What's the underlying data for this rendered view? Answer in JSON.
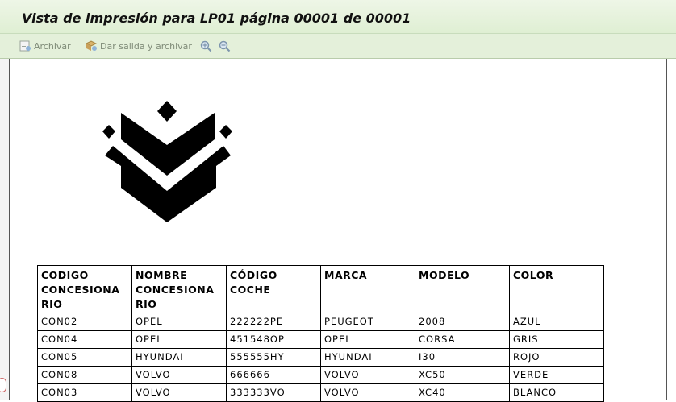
{
  "window": {
    "title": "Vista de impresión para LP01 página 00001 de 00001"
  },
  "toolbar": {
    "archive_label": "Archivar",
    "output_archive_label": "Dar salida y archivar",
    "zoom_in_icon": "zoom-in-icon",
    "zoom_out_icon": "zoom-out-icon"
  },
  "report": {
    "headers": [
      [
        "CODIGO",
        "CONCESIONA",
        "RIO"
      ],
      [
        "NOMBRE",
        "CONCESIONA",
        "RIO"
      ],
      [
        "CÓDIGO",
        "COCHE"
      ],
      [
        "MARCA"
      ],
      [
        "MODELO"
      ],
      [
        "COLOR"
      ]
    ],
    "rows": [
      [
        "CON02",
        "OPEL",
        "222222PE",
        "PEUGEOT",
        "2008",
        "AZUL"
      ],
      [
        "CON04",
        "OPEL",
        "451548OP",
        "OPEL",
        "CORSA",
        "GRIS"
      ],
      [
        "CON05",
        "HYUNDAI",
        "555555HY",
        "HYUNDAI",
        "I30",
        "ROJO"
      ],
      [
        "CON08",
        "VOLVO",
        "666666",
        "VOLVO",
        "XC50",
        "VERDE"
      ],
      [
        "CON03",
        "VOLVO",
        "333333VO",
        "VOLVO",
        "XC40",
        "BLANCO"
      ]
    ]
  }
}
